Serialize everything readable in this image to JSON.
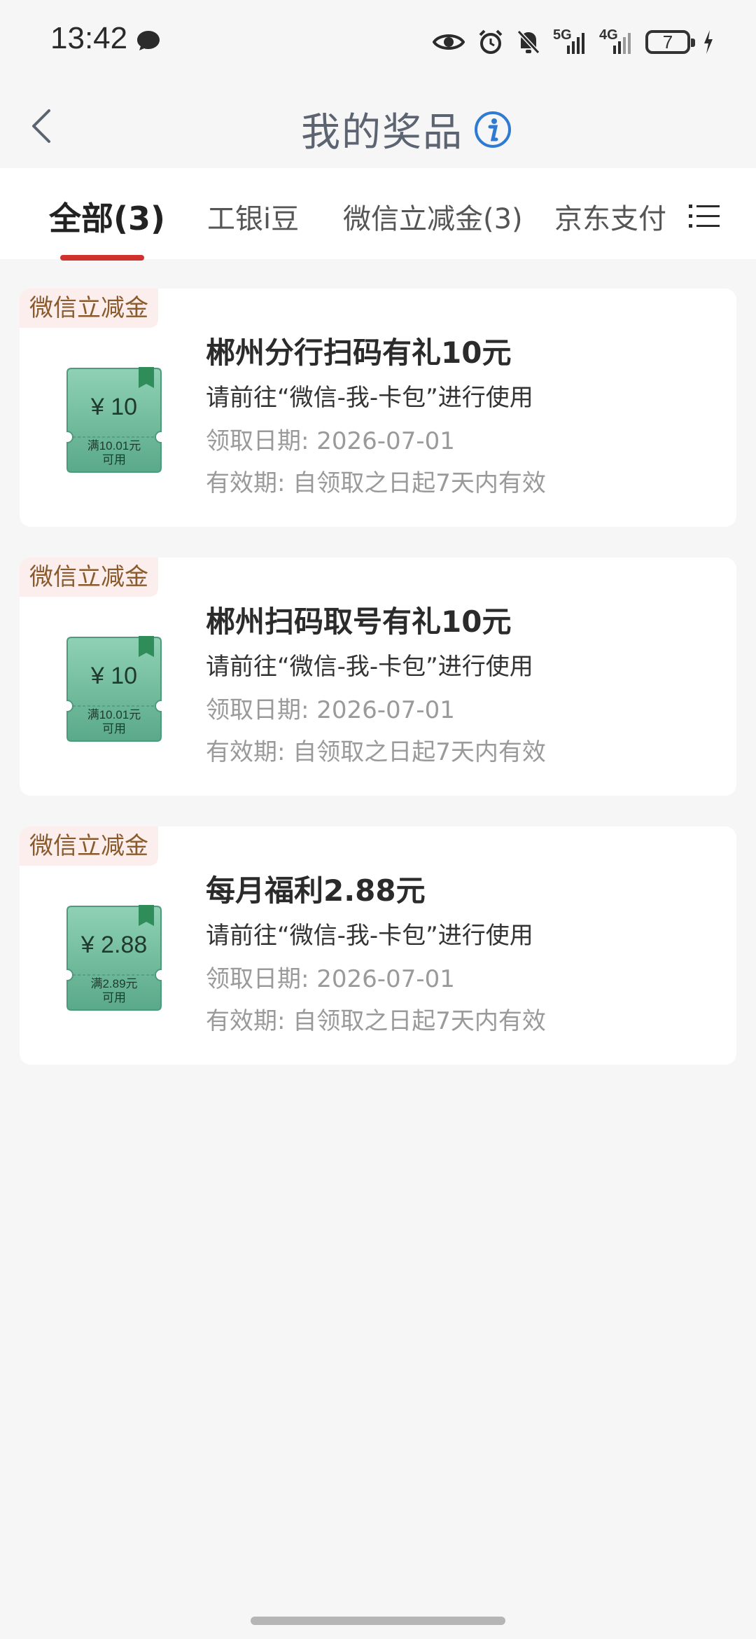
{
  "status_bar": {
    "time": "13:42",
    "network_5g": "5G",
    "network_4g": "4G",
    "battery_level": "7"
  },
  "header": {
    "title": "我的奖品",
    "back_icon": "chevron-left-icon",
    "info_icon": "info-icon"
  },
  "tabs": [
    {
      "label": "全部(3)",
      "active": true
    },
    {
      "label": "工银i豆",
      "active": false
    },
    {
      "label": "微信立减金(3)",
      "active": false
    },
    {
      "label": "京东支付",
      "active": false
    }
  ],
  "accent_color": "#d0312d",
  "prizes": [
    {
      "tag": "微信立减金",
      "title": "郴州分行扫码有礼10元",
      "desc": "请前往“微信-我-卡包”进行使用",
      "date": "领取日期: 2026-07-01",
      "validity": "有效期: 自领取之日起7天内有效",
      "coupon_amount": "¥ 10",
      "coupon_cond": "满10.01元",
      "coupon_usable": "可用"
    },
    {
      "tag": "微信立减金",
      "title": "郴州扫码取号有礼10元",
      "desc": "请前往“微信-我-卡包”进行使用",
      "date": "领取日期: 2026-07-01",
      "validity": "有效期: 自领取之日起7天内有效",
      "coupon_amount": "¥ 10",
      "coupon_cond": "满10.01元",
      "coupon_usable": "可用"
    },
    {
      "tag": "微信立减金",
      "title": "每月福利2.88元",
      "desc": "请前往“微信-我-卡包”进行使用",
      "date": "领取日期: 2026-07-01",
      "validity": "有效期: 自领取之日起7天内有效",
      "coupon_amount": "¥ 2.88",
      "coupon_cond": "满2.89元",
      "coupon_usable": "可用"
    }
  ]
}
